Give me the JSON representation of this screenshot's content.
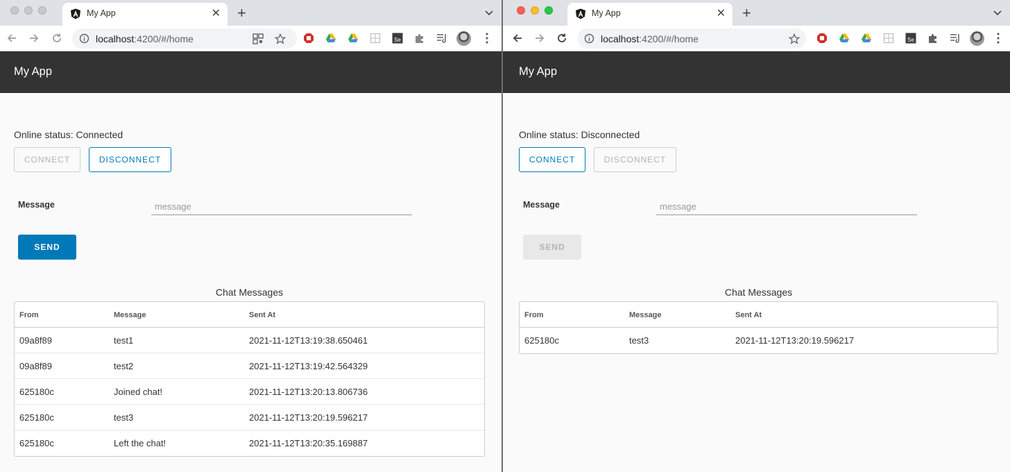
{
  "left": {
    "tab_title": "My App",
    "url_host": "localhost",
    "url_path": ":4200/#/home",
    "app_title": "My App",
    "status_text": "Online status: Connected",
    "connect_label": "CONNECT",
    "disconnect_label": "DISCONNECT",
    "message_label": "Message",
    "message_placeholder": "message",
    "send_label": "SEND",
    "table_caption": "Chat Messages",
    "columns": [
      "From",
      "Message",
      "Sent At"
    ],
    "rows": [
      {
        "from": "09a8f89",
        "message": "test1",
        "sent_at": "2021-11-12T13:19:38.650461"
      },
      {
        "from": "09a8f89",
        "message": "test2",
        "sent_at": "2021-11-12T13:19:42.564329"
      },
      {
        "from": "625180c",
        "message": "Joined chat!",
        "sent_at": "2021-11-12T13:20:13.806736"
      },
      {
        "from": "625180c",
        "message": "test3",
        "sent_at": "2021-11-12T13:20:19.596217"
      },
      {
        "from": "625180c",
        "message": "Left the chat!",
        "sent_at": "2021-11-12T13:20:35.169887"
      }
    ]
  },
  "right": {
    "tab_title": "My App",
    "url_host": "localhost",
    "url_path": ":4200/#/home",
    "app_title": "My App",
    "status_text": "Online status: Disconnected",
    "connect_label": "CONNECT",
    "disconnect_label": "DISCONNECT",
    "message_label": "Message",
    "message_placeholder": "message",
    "send_label": "SEND",
    "table_caption": "Chat Messages",
    "columns": [
      "From",
      "Message",
      "Sent At"
    ],
    "rows": [
      {
        "from": "625180c",
        "message": "test3",
        "sent_at": "2021-11-12T13:20:19.596217"
      }
    ]
  },
  "colors": {
    "primary": "#0079b8",
    "header_bg": "#333333",
    "disabled_text": "#b3b3b3"
  }
}
